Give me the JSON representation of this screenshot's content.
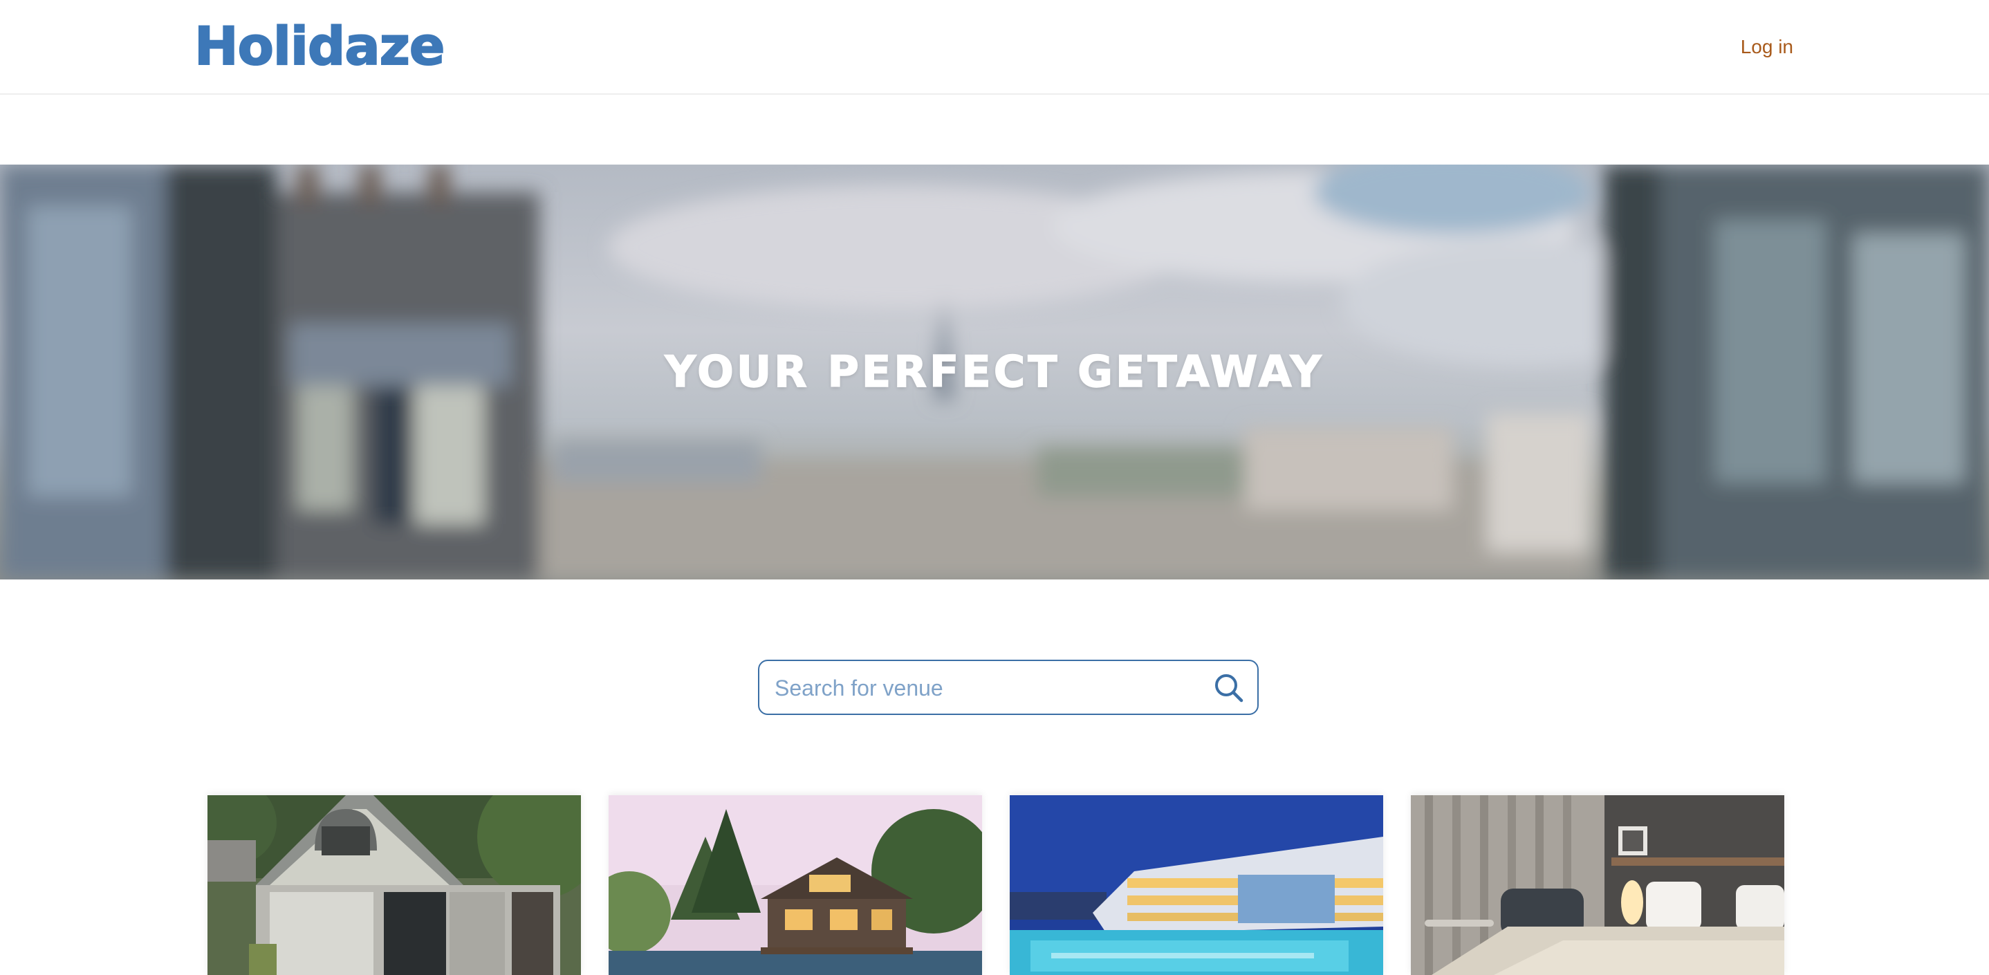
{
  "header": {
    "logo": "Holidaze",
    "login_label": "Log in",
    "brand_color": "#3d78b8",
    "login_color": "#a85a1b"
  },
  "hero": {
    "title": "YOUR PERFECT GETAWAY"
  },
  "search": {
    "placeholder": "Search for venue",
    "value": "",
    "icon": "search-icon"
  },
  "venues": [
    {
      "image": "cabin-house-photo"
    },
    {
      "image": "lakeside-lodge-photo"
    },
    {
      "image": "resort-pool-photo"
    },
    {
      "image": "hotel-bedroom-photo"
    }
  ]
}
